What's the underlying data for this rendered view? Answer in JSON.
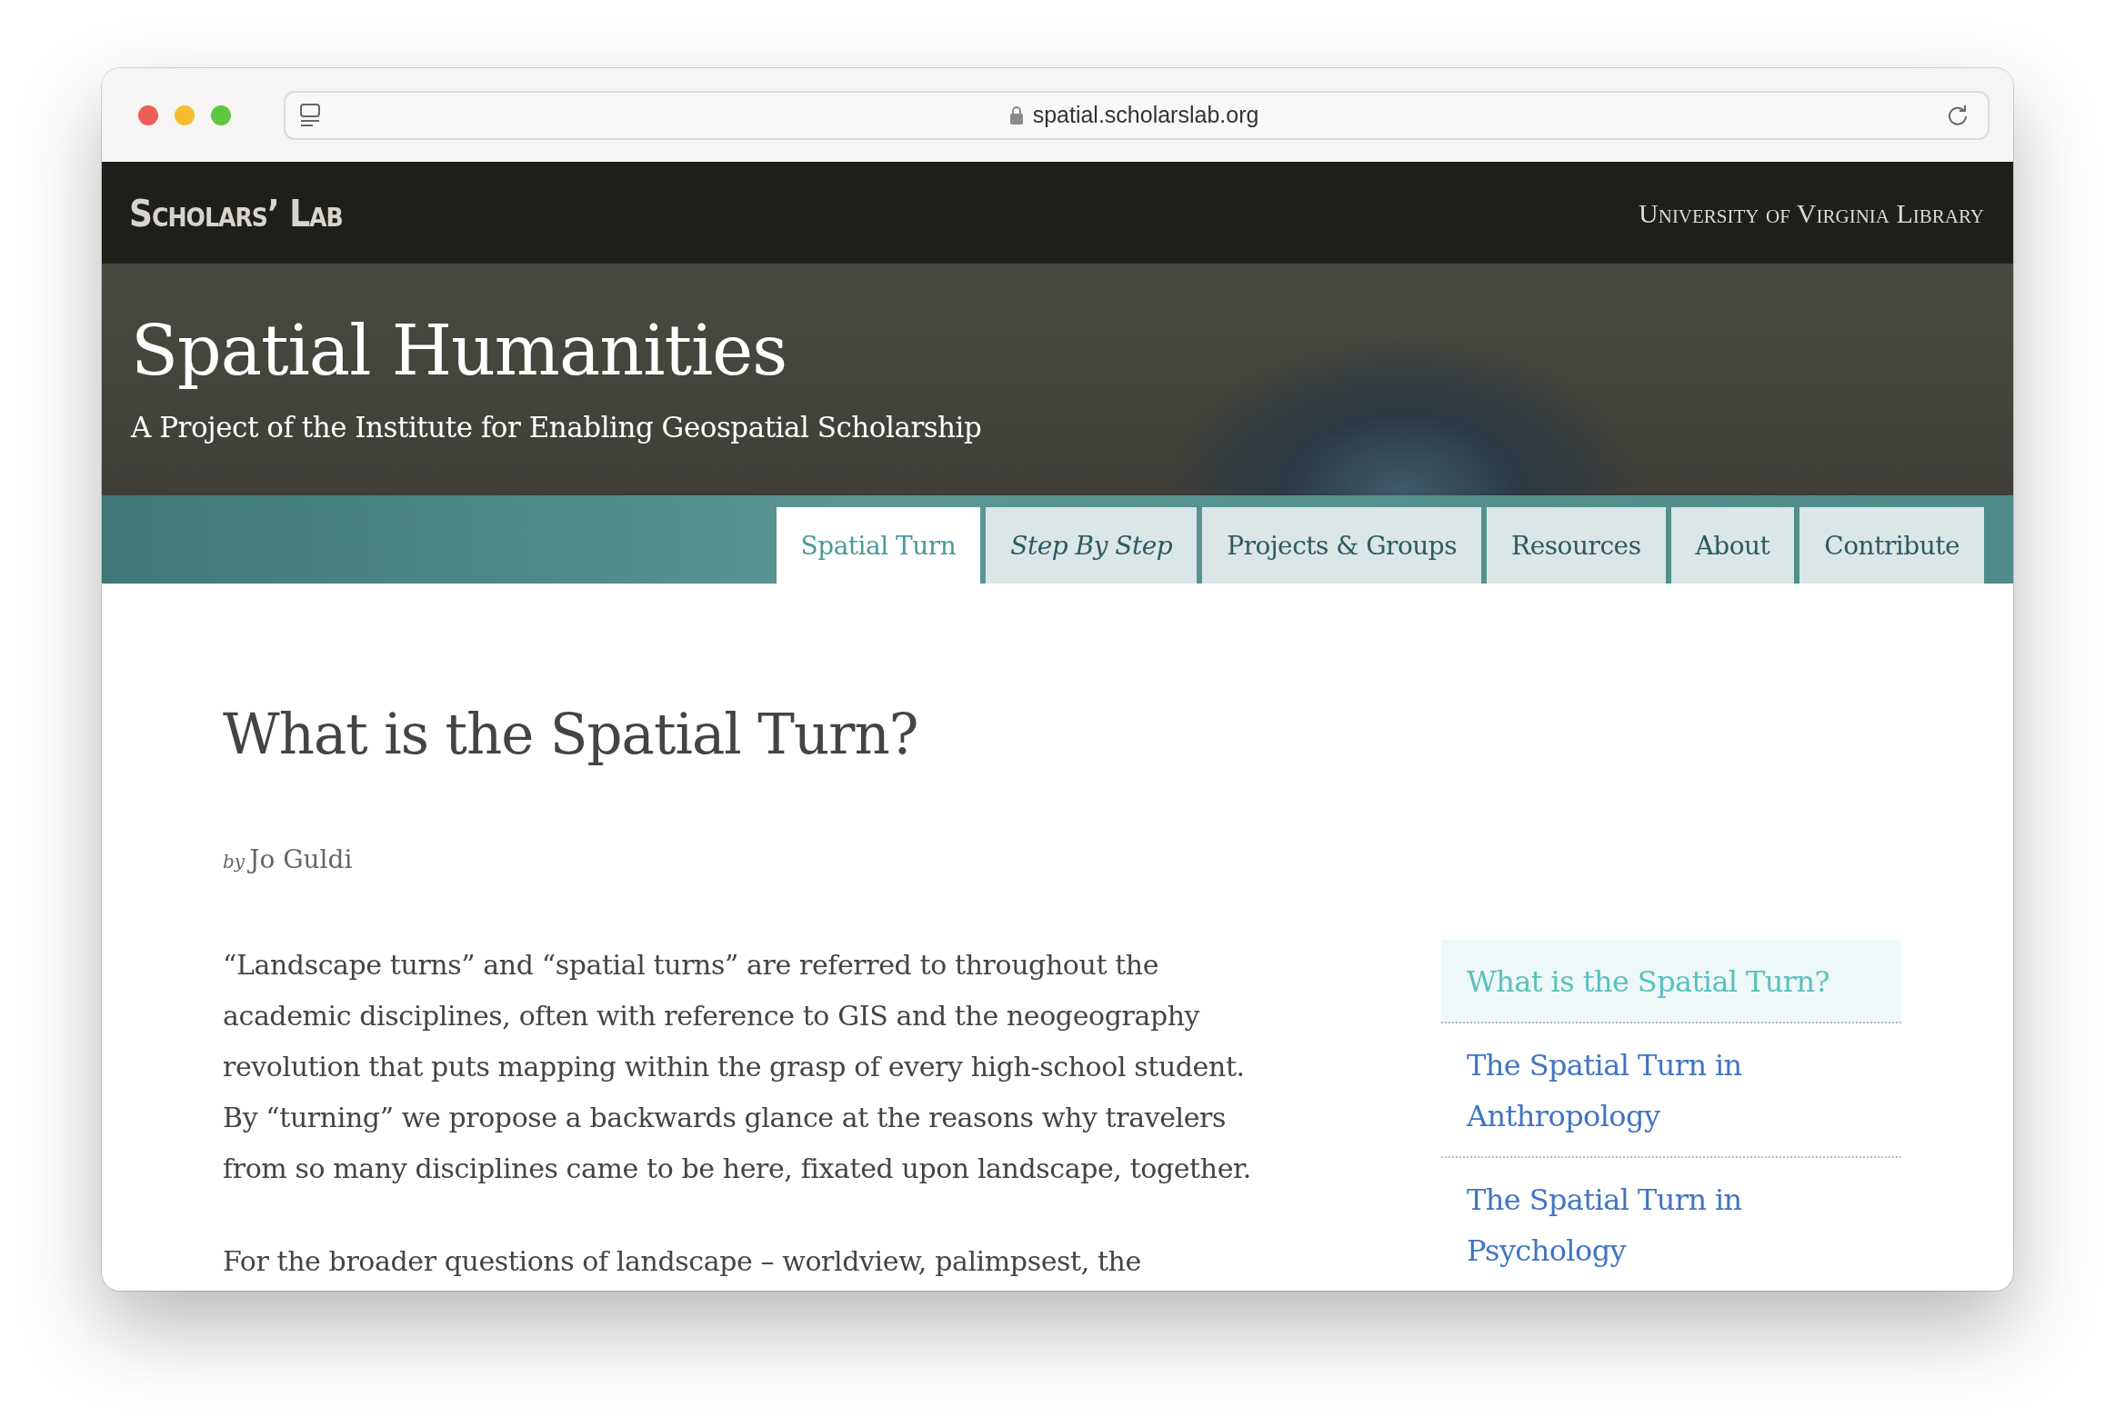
{
  "browser": {
    "url": "spatial.scholarslab.org"
  },
  "header": {
    "logo": "Scholars’ Lab",
    "library": "University of Virginia Library",
    "title": "Spatial Humanities",
    "subtitle": "A Project of the Institute for Enabling Geospatial Scholarship"
  },
  "nav": [
    {
      "label": "Spatial Turn",
      "selected": true,
      "italic": false
    },
    {
      "label": "Step By Step",
      "selected": false,
      "italic": true
    },
    {
      "label": "Projects & Groups",
      "selected": false,
      "italic": false
    },
    {
      "label": "Resources",
      "selected": false,
      "italic": false
    },
    {
      "label": "About",
      "selected": false,
      "italic": false
    },
    {
      "label": "Contribute",
      "selected": false,
      "italic": false
    }
  ],
  "article": {
    "title": "What is the Spatial Turn?",
    "byline_prefix": "by",
    "author": "Jo Guldi",
    "paragraphs": [
      "“Landscape turns” and “spatial turns” are referred to throughout the academic disciplines, often with reference to GIS and the neogeography revolution that puts mapping within the grasp of every high-school student. By “turning” we propose a backwards glance at the reasons why travelers from so many disciplines came to be here, fixated upon landscape, together.",
      "For the broader questions of landscape – worldview, palimpsest, the"
    ]
  },
  "sidebar": {
    "items": [
      {
        "label": "What is the Spatial Turn?",
        "selected": true
      },
      {
        "label": "The Spatial Turn in Anthropology",
        "selected": false
      },
      {
        "label": "The Spatial Turn in Psychology",
        "selected": false
      }
    ]
  }
}
